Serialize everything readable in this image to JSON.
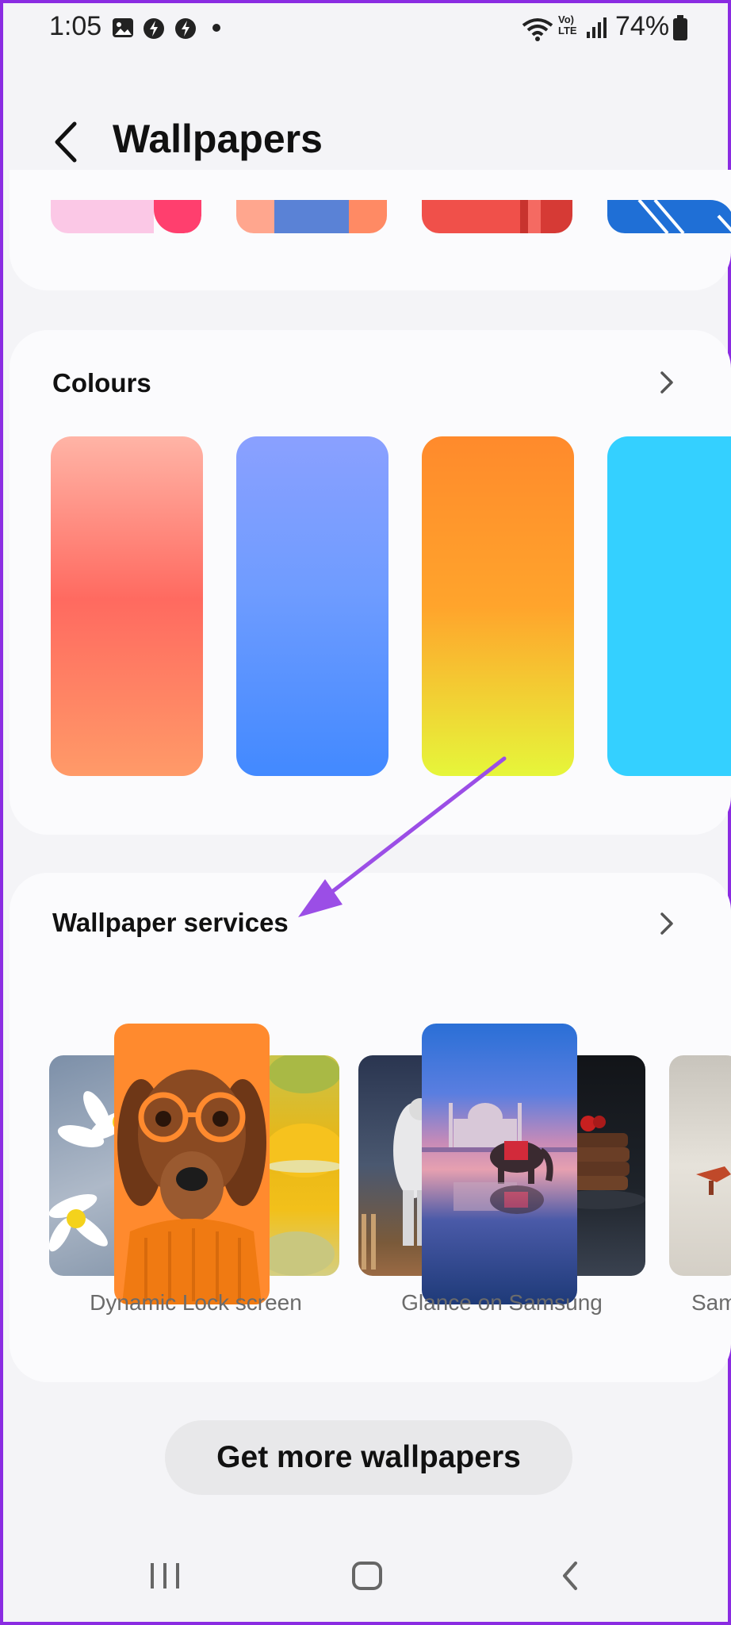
{
  "status_bar": {
    "time": "1:05",
    "volte": "Vo) LTE",
    "battery": "74%",
    "icons": [
      "gallery-icon",
      "app-notification-icon",
      "app-notification-icon",
      "dot-icon",
      "wifi-icon",
      "signal-icon",
      "battery-icon"
    ]
  },
  "header": {
    "title": "Wallpapers"
  },
  "sections": {
    "colours": {
      "title": "Colours"
    },
    "services": {
      "title": "Wallpaper services",
      "items": [
        {
          "label": "Dynamic Lock screen"
        },
        {
          "label": "Glance on Samsung"
        },
        {
          "label": "Sam"
        }
      ]
    }
  },
  "colours": {
    "swatches": [
      {
        "top": "#ffb2a4",
        "middle": "#ff6a60",
        "bottom": "#ff9366"
      },
      {
        "top": "#8aa2ff",
        "middle": "#6f9bff",
        "bottom": "#4688ff"
      },
      {
        "top": "#ff8c2c",
        "middle": "#ffa72c",
        "bottom": "#e7f53a"
      },
      {
        "top": "#36d0ff",
        "middle": "#36d0ff",
        "bottom": "#32c4ff"
      }
    ]
  },
  "buttons": {
    "get_more": "Get more wallpapers"
  },
  "accent": "#9b4ee6"
}
